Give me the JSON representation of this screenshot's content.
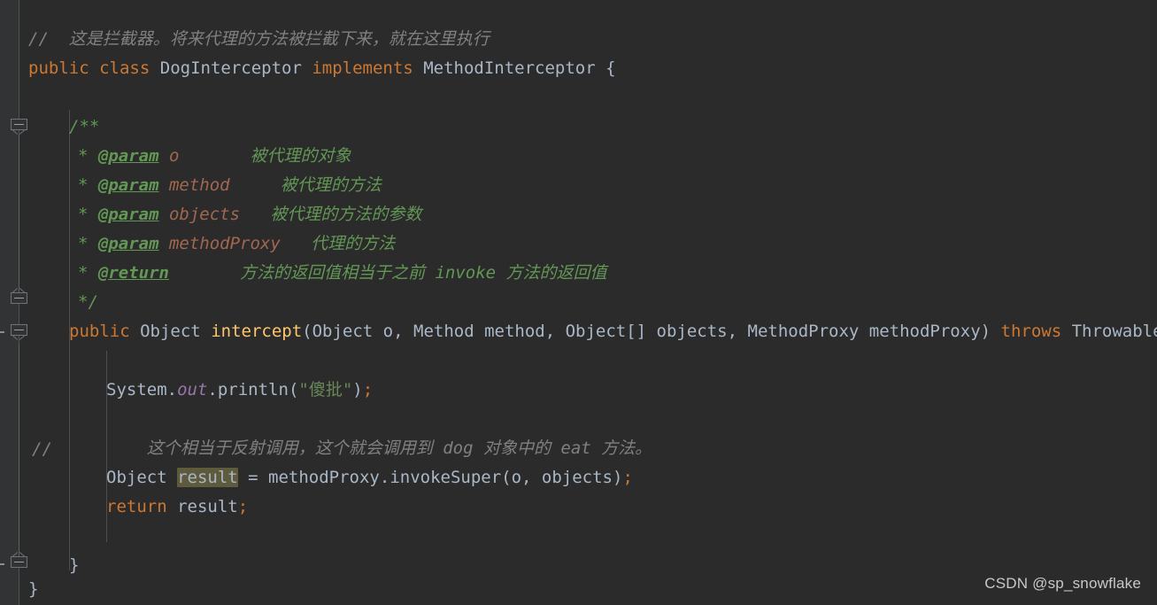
{
  "editor": {
    "background": "#2b2b2b",
    "gutter_background": "#313335",
    "font_size_px": 19,
    "line_height_px": 33
  },
  "colors": {
    "keyword": "#cc7832",
    "identifier": "#a9b7c6",
    "method": "#ffc66d",
    "string": "#6a8759",
    "field": "#9876aa",
    "comment": "#808080",
    "javadoc": "#629755",
    "javadoc_param": "#a2674f",
    "occurrence_highlight": "#5d5b3c",
    "indent_guide": "#4b4f52"
  },
  "code": {
    "lines": [
      {
        "id": "line-class-comment",
        "tokens": [
          {
            "cls": "cmt",
            "text": "//  这是拦截器。将来代理的方法被拦截下来，就在这里执行"
          }
        ]
      },
      {
        "id": "line-class-decl",
        "tokens": [
          {
            "cls": "kw",
            "text": "public"
          },
          {
            "cls": "punc",
            "text": " "
          },
          {
            "cls": "kw",
            "text": "class"
          },
          {
            "cls": "punc",
            "text": " "
          },
          {
            "cls": "type",
            "text": "DogInterceptor"
          },
          {
            "cls": "punc",
            "text": " "
          },
          {
            "cls": "kw",
            "text": "implements"
          },
          {
            "cls": "punc",
            "text": " "
          },
          {
            "cls": "type",
            "text": "MethodInterceptor"
          },
          {
            "cls": "punc",
            "text": " {"
          }
        ]
      },
      {
        "id": "line-javadoc-open",
        "tokens": [
          {
            "cls": "doc",
            "text": "/**"
          }
        ]
      },
      {
        "id": "line-javadoc-param-o",
        "tokens": [
          {
            "cls": "docstar",
            "text": "* "
          },
          {
            "cls": "doctag",
            "text": "@param"
          },
          {
            "cls": "docparam",
            "text": " o"
          },
          {
            "cls": "doc",
            "text": "       被代理的对象"
          }
        ]
      },
      {
        "id": "line-javadoc-param-method",
        "tokens": [
          {
            "cls": "docstar",
            "text": "* "
          },
          {
            "cls": "doctag",
            "text": "@param"
          },
          {
            "cls": "docparam",
            "text": " method"
          },
          {
            "cls": "doc",
            "text": "     被代理的方法"
          }
        ]
      },
      {
        "id": "line-javadoc-param-objects",
        "tokens": [
          {
            "cls": "docstar",
            "text": "* "
          },
          {
            "cls": "doctag",
            "text": "@param"
          },
          {
            "cls": "docparam",
            "text": " objects"
          },
          {
            "cls": "doc",
            "text": "   被代理的方法的参数"
          }
        ]
      },
      {
        "id": "line-javadoc-param-methodproxy",
        "tokens": [
          {
            "cls": "docstar",
            "text": "* "
          },
          {
            "cls": "doctag",
            "text": "@param"
          },
          {
            "cls": "docparam",
            "text": " methodProxy"
          },
          {
            "cls": "doc",
            "text": "   代理的方法"
          }
        ]
      },
      {
        "id": "line-javadoc-return",
        "tokens": [
          {
            "cls": "docstar",
            "text": "* "
          },
          {
            "cls": "doctag",
            "text": "@return"
          },
          {
            "cls": "doc",
            "text": "       方法的返回值相当于之前 invoke 方法的返回值"
          }
        ]
      },
      {
        "id": "line-javadoc-close",
        "tokens": [
          {
            "cls": "doc",
            "text": "*/"
          }
        ]
      },
      {
        "id": "line-intercept-signature",
        "tokens": [
          {
            "cls": "kw",
            "text": "public"
          },
          {
            "cls": "punc",
            "text": " "
          },
          {
            "cls": "type",
            "text": "Object"
          },
          {
            "cls": "punc",
            "text": " "
          },
          {
            "cls": "mth",
            "text": "intercept"
          },
          {
            "cls": "punc",
            "text": "("
          },
          {
            "cls": "type",
            "text": "Object"
          },
          {
            "cls": "punc",
            "text": " o, "
          },
          {
            "cls": "type",
            "text": "Method"
          },
          {
            "cls": "punc",
            "text": " method, "
          },
          {
            "cls": "type",
            "text": "Object"
          },
          {
            "cls": "punc",
            "text": "[] objects, "
          },
          {
            "cls": "type",
            "text": "MethodProxy"
          },
          {
            "cls": "punc",
            "text": " methodProxy) "
          },
          {
            "cls": "kw",
            "text": "throws"
          },
          {
            "cls": "punc",
            "text": " "
          },
          {
            "cls": "type",
            "text": "Throwable"
          },
          {
            "cls": "punc",
            "text": " {"
          }
        ]
      },
      {
        "id": "line-blank-1",
        "tokens": []
      },
      {
        "id": "line-println",
        "tokens": [
          {
            "cls": "type",
            "text": "System."
          },
          {
            "cls": "fld",
            "text": "out"
          },
          {
            "cls": "punc",
            "text": "."
          },
          {
            "cls": "type",
            "text": "println"
          },
          {
            "cls": "punc",
            "text": "("
          },
          {
            "cls": "str",
            "text": "\"傻批\""
          },
          {
            "cls": "punc",
            "text": ")"
          },
          {
            "cls": "semi",
            "text": ";"
          }
        ]
      },
      {
        "id": "line-blank-2",
        "tokens": []
      },
      {
        "id": "line-reflect-comment",
        "tokens": [
          {
            "cls": "cmt",
            "text": "    这个相当于反射调用，这个就会调用到 dog 对象中的 eat 方法。"
          }
        ]
      },
      {
        "id": "line-invoke-super",
        "tokens": [
          {
            "cls": "type",
            "text": "Object "
          },
          {
            "cls": "type hl",
            "text": "result"
          },
          {
            "cls": "punc",
            "text": " = methodProxy."
          },
          {
            "cls": "type",
            "text": "invokeSuper"
          },
          {
            "cls": "punc",
            "text": "(o, objects)"
          },
          {
            "cls": "semi",
            "text": ";"
          }
        ]
      },
      {
        "id": "line-return-result",
        "tokens": [
          {
            "cls": "kw",
            "text": "return"
          },
          {
            "cls": "punc",
            "text": " result"
          },
          {
            "cls": "semi",
            "text": ";"
          }
        ]
      },
      {
        "id": "line-blank-3",
        "tokens": []
      },
      {
        "id": "line-close-method",
        "tokens": [
          {
            "cls": "punc",
            "text": "}"
          }
        ]
      },
      {
        "id": "line-close-class",
        "tokens": [
          {
            "cls": "punc",
            "text": "}"
          }
        ]
      }
    ],
    "lead_comments": [
      {
        "id": "lead-comment-reflect",
        "text": "//"
      }
    ]
  },
  "watermark": {
    "text": "CSDN @sp_snowflake"
  }
}
